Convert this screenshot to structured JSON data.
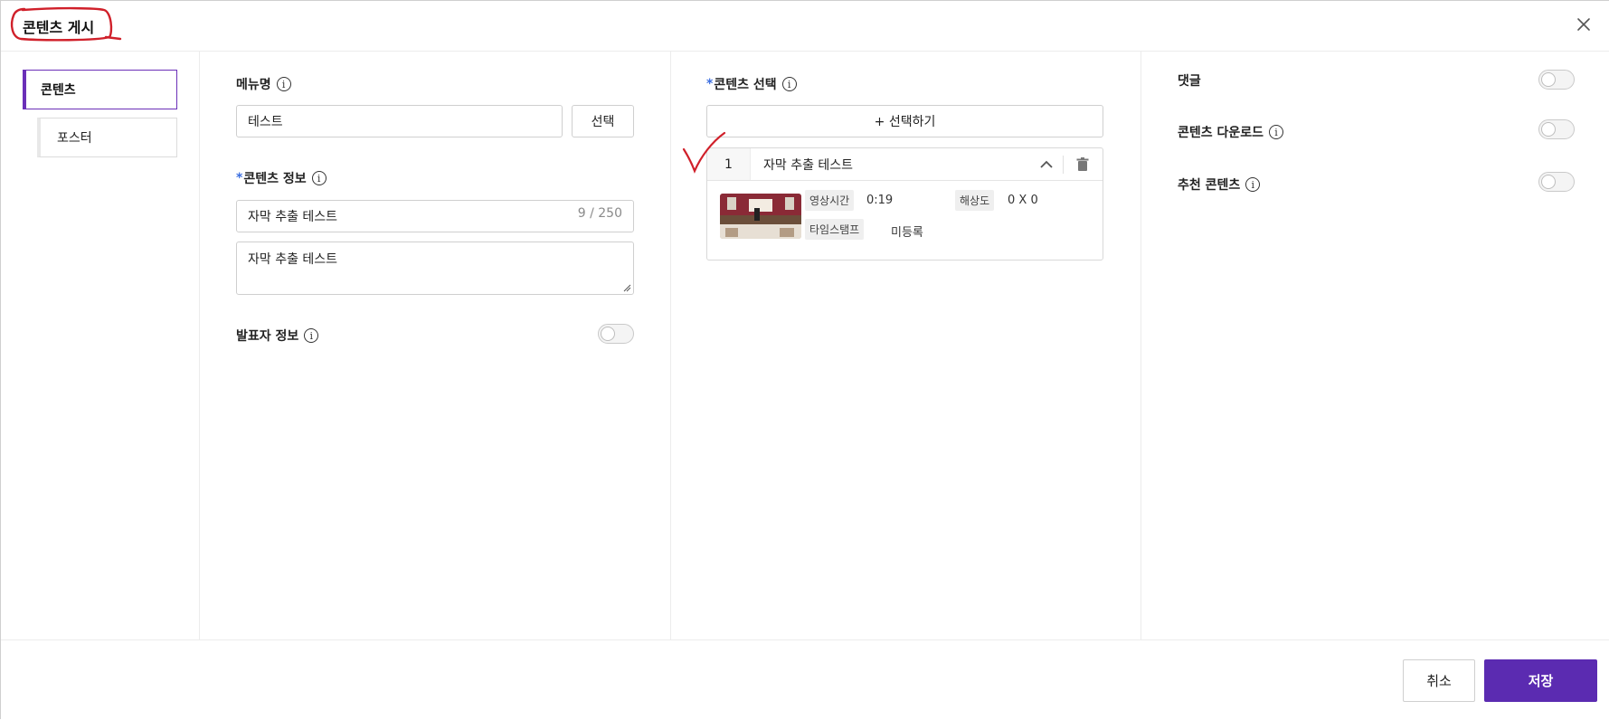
{
  "dialog": {
    "title": "콘텐츠 게시",
    "close_icon": "close-icon"
  },
  "nav": {
    "items": [
      {
        "label": "콘텐츠",
        "active": true
      },
      {
        "label": "포스터",
        "active": false
      }
    ]
  },
  "form": {
    "menu_name": {
      "label": "메뉴명",
      "value": "테스트",
      "select_button": "선택"
    },
    "content_info": {
      "label": "콘텐츠 정보",
      "required_mark": "*",
      "title_value": "자막 추출 테스트",
      "counter": "9 / 250",
      "description_value": "자막 추출 테스트"
    },
    "presenter_info": {
      "label": "발표자 정보",
      "enabled": false
    }
  },
  "content_select": {
    "label": "콘텐츠 선택",
    "required_mark": "*",
    "add_button": "+ 선택하기",
    "items": [
      {
        "index": "1",
        "title": "자막 추출 테스트",
        "duration_label": "영상시간",
        "duration_value": "0:19",
        "resolution_label": "해상도",
        "resolution_value": "0 X 0",
        "timestamp_label": "타임스탬프",
        "timestamp_value": "미등록"
      }
    ]
  },
  "settings": {
    "comments": {
      "label": "댓글",
      "enabled": false
    },
    "download": {
      "label": "콘텐츠 다운로드",
      "enabled": false
    },
    "recommended": {
      "label": "추천 콘텐츠",
      "enabled": false
    }
  },
  "footer": {
    "cancel_label": "취소",
    "save_label": "저장"
  },
  "colors": {
    "accent": "#5b2bb1",
    "required": "#3b6ee0",
    "annotation": "#d0202a"
  }
}
